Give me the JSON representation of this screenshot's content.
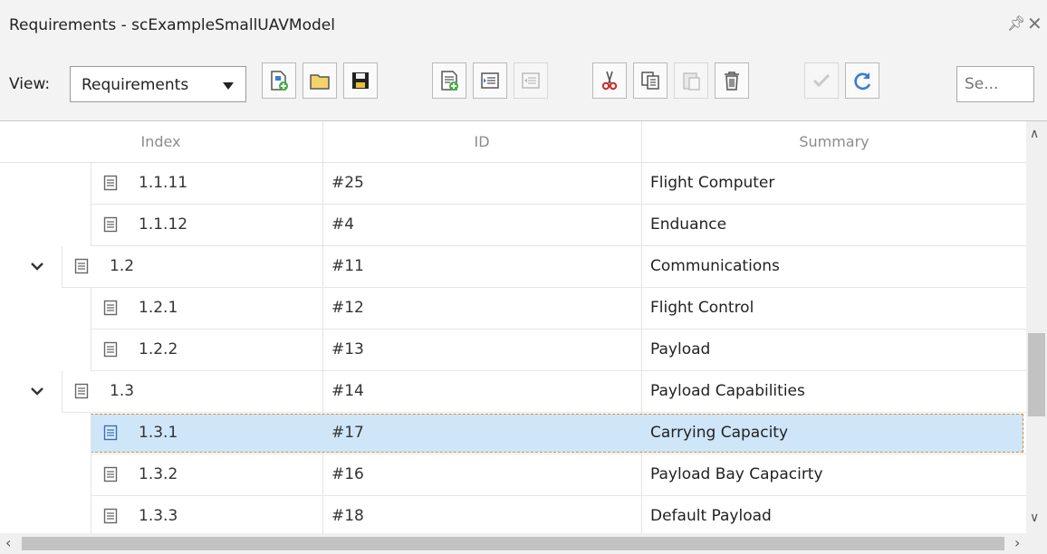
{
  "window": {
    "title": "Requirements - scExampleSmallUAVModel"
  },
  "toolbar": {
    "view_label": "View:",
    "view_value": "Requirements",
    "search_placeholder": "Se...",
    "buttons": [
      {
        "name": "new-requirement-set",
        "icon": "new-file-icon",
        "disabled": false
      },
      {
        "name": "open",
        "icon": "folder-icon",
        "disabled": false
      },
      {
        "name": "save",
        "icon": "save-icon",
        "disabled": false
      },
      {
        "name": "add-requirement",
        "icon": "add-requirement-icon",
        "disabled": false
      },
      {
        "name": "outdent",
        "icon": "outdent-icon",
        "disabled": false
      },
      {
        "name": "indent",
        "icon": "indent-icon",
        "disabled": true
      },
      {
        "name": "cut",
        "icon": "scissors-icon",
        "disabled": false
      },
      {
        "name": "copy",
        "icon": "copy-icon",
        "disabled": false
      },
      {
        "name": "paste",
        "icon": "paste-icon",
        "disabled": true
      },
      {
        "name": "delete",
        "icon": "trash-icon",
        "disabled": false
      },
      {
        "name": "verify",
        "icon": "check-icon",
        "disabled": true
      },
      {
        "name": "refresh",
        "icon": "refresh-icon",
        "disabled": false
      }
    ]
  },
  "table": {
    "columns": [
      "Index",
      "ID",
      "Summary"
    ],
    "rows": [
      {
        "index": "1.1.11",
        "id": "#25",
        "summary": "Flight Computer",
        "level": 3,
        "expanded": null,
        "selected": false
      },
      {
        "index": "1.1.12",
        "id": "#4",
        "summary": "Enduance",
        "level": 3,
        "expanded": null,
        "selected": false
      },
      {
        "index": "1.2",
        "id": "#11",
        "summary": "Communications",
        "level": 2,
        "expanded": true,
        "selected": false
      },
      {
        "index": "1.2.1",
        "id": "#12",
        "summary": "Flight Control",
        "level": 3,
        "expanded": null,
        "selected": false
      },
      {
        "index": "1.2.2",
        "id": "#13",
        "summary": "Payload",
        "level": 3,
        "expanded": null,
        "selected": false
      },
      {
        "index": "1.3",
        "id": "#14",
        "summary": "Payload Capabilities",
        "level": 2,
        "expanded": true,
        "selected": false
      },
      {
        "index": "1.3.1",
        "id": "#17",
        "summary": "Carrying Capacity",
        "level": 3,
        "expanded": null,
        "selected": true
      },
      {
        "index": "1.3.2",
        "id": "#16",
        "summary": "Payload Bay Capacirty",
        "level": 3,
        "expanded": null,
        "selected": false
      },
      {
        "index": "1.3.3",
        "id": "#18",
        "summary": "Default Payload",
        "level": 3,
        "expanded": null,
        "selected": false
      }
    ]
  },
  "colors": {
    "selection": "#cfe6f8",
    "selection_border": "#d58a3a"
  }
}
